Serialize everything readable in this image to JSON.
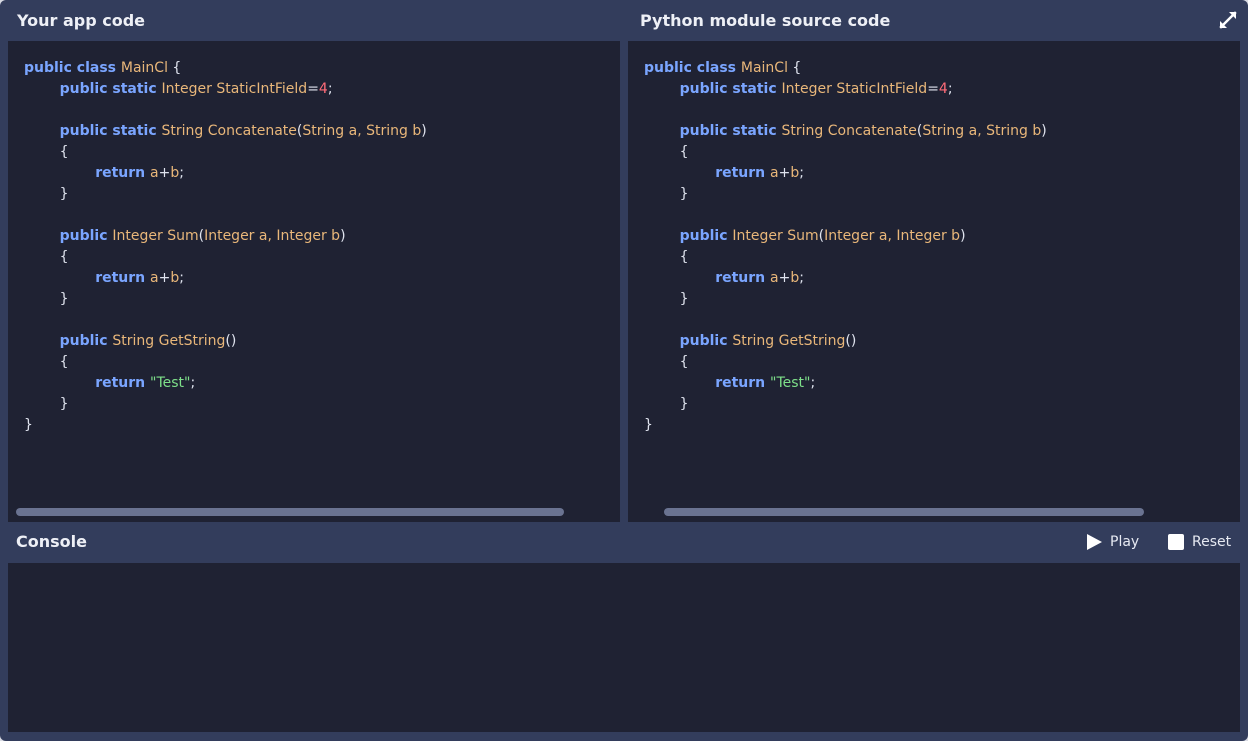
{
  "panes": {
    "left_title": "Your app code",
    "right_title": "Python module source code"
  },
  "code_lines": [
    [
      [
        "k",
        "public class "
      ],
      [
        "t",
        "MainCl "
      ],
      [
        "p",
        "{"
      ]
    ],
    [
      [
        "p",
        "\t"
      ],
      [
        "k",
        "public static "
      ],
      [
        "t",
        "Integer StaticIntField"
      ],
      [
        "p",
        "="
      ],
      [
        "n",
        "4"
      ],
      [
        "p",
        ";"
      ]
    ],
    [],
    [
      [
        "p",
        "\t"
      ],
      [
        "k",
        "public static "
      ],
      [
        "t",
        "String Concatenate"
      ],
      [
        "p",
        "("
      ],
      [
        "t",
        "String a, String b"
      ],
      [
        "p",
        ")"
      ]
    ],
    [
      [
        "p",
        "\t{"
      ]
    ],
    [
      [
        "p",
        "\t\t"
      ],
      [
        "k",
        "return "
      ],
      [
        "t",
        "a"
      ],
      [
        "p",
        "+"
      ],
      [
        "t",
        "b"
      ],
      [
        "p",
        ";"
      ]
    ],
    [
      [
        "p",
        "\t}"
      ]
    ],
    [],
    [
      [
        "p",
        "\t"
      ],
      [
        "k",
        "public "
      ],
      [
        "t",
        "Integer Sum"
      ],
      [
        "p",
        "("
      ],
      [
        "t",
        "Integer a, Integer b"
      ],
      [
        "p",
        ")"
      ]
    ],
    [
      [
        "p",
        "\t{"
      ]
    ],
    [
      [
        "p",
        "\t\t"
      ],
      [
        "k",
        "return "
      ],
      [
        "t",
        "a"
      ],
      [
        "p",
        "+"
      ],
      [
        "t",
        "b"
      ],
      [
        "p",
        ";"
      ]
    ],
    [
      [
        "p",
        "\t}"
      ]
    ],
    [],
    [
      [
        "p",
        "\t"
      ],
      [
        "k",
        "public "
      ],
      [
        "t",
        "String GetString"
      ],
      [
        "p",
        "()"
      ]
    ],
    [
      [
        "p",
        "\t{"
      ]
    ],
    [
      [
        "p",
        "\t\t"
      ],
      [
        "k",
        "return "
      ],
      [
        "s",
        "\"Test\""
      ],
      [
        "p",
        ";"
      ]
    ],
    [
      [
        "p",
        "\t}"
      ]
    ],
    [
      [
        "p",
        "}"
      ]
    ]
  ],
  "console": {
    "title": "Console",
    "play_label": "Play",
    "reset_label": "Reset",
    "output": ""
  },
  "icons": {
    "expand": "expand-icon",
    "play": "play-icon",
    "reset": "stop-icon"
  },
  "colors": {
    "keyword": "#7aa5ff",
    "type": "#e9b77a",
    "number": "#ff6b78",
    "string": "#7ee08a",
    "editor_bg": "#1f2233",
    "chrome_bg": "#333d5c"
  }
}
